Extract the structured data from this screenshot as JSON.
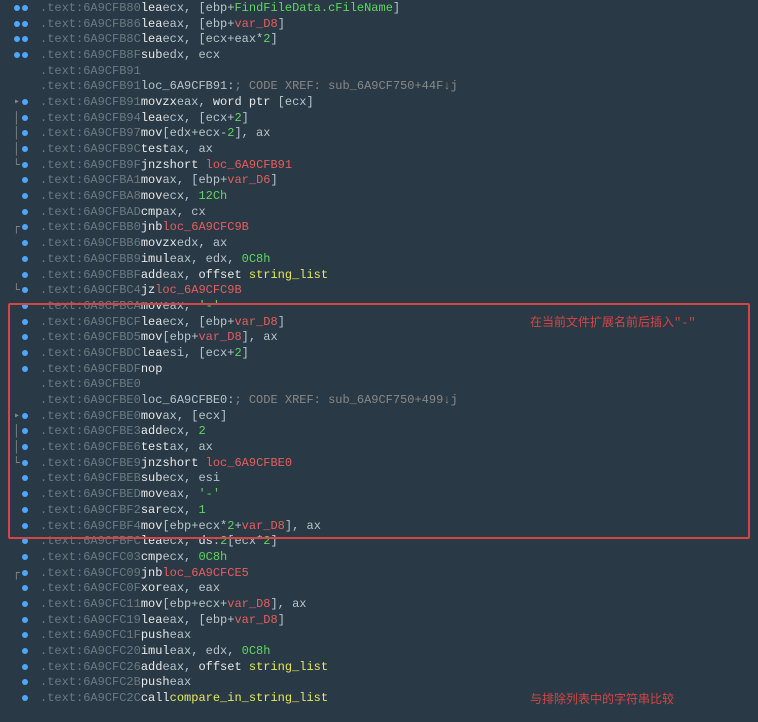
{
  "lines": [
    {
      "g": ".. ",
      "addr": ".text:6A9CFB80",
      "lbl": "",
      "mn": "lea",
      "ops": [
        {
          "t": "ecx, [",
          "c": "op"
        },
        {
          "t": "ebp",
          "c": "op"
        },
        {
          "t": "+",
          "c": "op"
        },
        {
          "t": "FindFileData.cFileName",
          "c": "str"
        },
        {
          "t": "]",
          "c": "op"
        }
      ]
    },
    {
      "g": ".. ",
      "addr": ".text:6A9CFB86",
      "lbl": "",
      "mn": "lea",
      "ops": [
        {
          "t": "eax, [",
          "c": "op"
        },
        {
          "t": "ebp",
          "c": "op"
        },
        {
          "t": "+",
          "c": "op"
        },
        {
          "t": "var_D8",
          "c": "var"
        },
        {
          "t": "]",
          "c": "op"
        }
      ]
    },
    {
      "g": ".. ",
      "addr": ".text:6A9CFB8C",
      "lbl": "",
      "mn": "lea",
      "ops": [
        {
          "t": "ecx, [ecx+eax*",
          "c": "op"
        },
        {
          "t": "2",
          "c": "num"
        },
        {
          "t": "]",
          "c": "op"
        }
      ]
    },
    {
      "g": ".. ",
      "addr": ".text:6A9CFB8F",
      "lbl": "",
      "mn": "sub",
      "ops": [
        {
          "t": "edx, ecx",
          "c": "op"
        }
      ]
    },
    {
      "g": "   ",
      "addr": ".text:6A9CFB91",
      "lbl": "",
      "mn": "",
      "ops": []
    },
    {
      "g": "   ",
      "addr": ".text:6A9CFB91",
      "lbl": "loc_6A9CFB91:",
      "xref": "; CODE XREF: sub_6A9CF750+44F↓j",
      "mn": "",
      "ops": []
    },
    {
      "g": "a. ",
      "addr": ".text:6A9CFB91",
      "lbl": "",
      "mn": "movzx",
      "ops": [
        {
          "t": "eax, ",
          "c": "op"
        },
        {
          "t": "word ptr",
          "c": "kw"
        },
        {
          "t": " [ecx]",
          "c": "op"
        }
      ]
    },
    {
      "g": ":. ",
      "addr": ".text:6A9CFB94",
      "lbl": "",
      "mn": "lea",
      "ops": [
        {
          "t": "ecx, [ecx+",
          "c": "op"
        },
        {
          "t": "2",
          "c": "num"
        },
        {
          "t": "]",
          "c": "op"
        }
      ]
    },
    {
      "g": ":. ",
      "addr": ".text:6A9CFB97",
      "lbl": "",
      "mn": "mov",
      "ops": [
        {
          "t": "[edx+ecx-",
          "c": "op"
        },
        {
          "t": "2",
          "c": "num"
        },
        {
          "t": "], ax",
          "c": "op"
        }
      ]
    },
    {
      "g": ":. ",
      "addr": ".text:6A9CFB9C",
      "lbl": "",
      "mn": "test",
      "ops": [
        {
          "t": "ax, ax",
          "c": "op"
        }
      ]
    },
    {
      "g": "L. ",
      "addr": ".text:6A9CFB9F",
      "lbl": "",
      "mn": "jnz",
      "ops": [
        {
          "t": "short ",
          "c": "kw"
        },
        {
          "t": "loc_6A9CFB91",
          "c": "ref"
        }
      ]
    },
    {
      "g": " . ",
      "addr": ".text:6A9CFBA1",
      "lbl": "",
      "mn": "mov",
      "ops": [
        {
          "t": "ax, [",
          "c": "op"
        },
        {
          "t": "ebp",
          "c": "op"
        },
        {
          "t": "+",
          "c": "op"
        },
        {
          "t": "var_D6",
          "c": "var"
        },
        {
          "t": "]",
          "c": "op"
        }
      ]
    },
    {
      "g": " . ",
      "addr": ".text:6A9CFBA8",
      "lbl": "",
      "mn": "mov",
      "ops": [
        {
          "t": "ecx, ",
          "c": "op"
        },
        {
          "t": "12Ch",
          "c": "num"
        }
      ]
    },
    {
      "g": " . ",
      "addr": ".text:6A9CFBAD",
      "lbl": "",
      "mn": "cmp",
      "ops": [
        {
          "t": "ax, cx",
          "c": "op"
        }
      ]
    },
    {
      "g": "d. ",
      "addr": ".text:6A9CFBB0",
      "lbl": "",
      "mn": "jnb",
      "ops": [
        {
          "t": "loc_6A9CFC9B",
          "c": "ref"
        }
      ]
    },
    {
      "g": " . ",
      "addr": ".text:6A9CFBB6",
      "lbl": "",
      "mn": "movzx",
      "ops": [
        {
          "t": "edx, ax",
          "c": "op"
        }
      ]
    },
    {
      "g": " . ",
      "addr": ".text:6A9CFBB9",
      "lbl": "",
      "mn": "imul",
      "ops": [
        {
          "t": "eax, edx, ",
          "c": "op"
        },
        {
          "t": "0C8h",
          "c": "num"
        }
      ]
    },
    {
      "g": " . ",
      "addr": ".text:6A9CFBBF",
      "lbl": "",
      "mn": "add",
      "ops": [
        {
          "t": "eax, ",
          "c": "op"
        },
        {
          "t": "offset",
          "c": "kw"
        },
        {
          "t": " ",
          "c": "op"
        },
        {
          "t": "string_list",
          "c": "func"
        }
      ]
    },
    {
      "g": "b. ",
      "addr": ".text:6A9CFBC4",
      "lbl": "",
      "mn": "jz",
      "ops": [
        {
          "t": "loc_6A9CFC9B",
          "c": "ref"
        }
      ]
    },
    {
      "g": " . ",
      "addr": ".text:6A9CFBCA",
      "lbl": "",
      "mn": "mov",
      "ops": [
        {
          "t": "eax, ",
          "c": "op"
        },
        {
          "t": "'-'",
          "c": "str"
        }
      ]
    },
    {
      "g": " . ",
      "addr": ".text:6A9CFBCF",
      "lbl": "",
      "mn": "lea",
      "ops": [
        {
          "t": "ecx, [",
          "c": "op"
        },
        {
          "t": "ebp",
          "c": "op"
        },
        {
          "t": "+",
          "c": "op"
        },
        {
          "t": "var_D8",
          "c": "var"
        },
        {
          "t": "]",
          "c": "op"
        }
      ],
      "annot": "在当前文件扩展名前后插入\"-\""
    },
    {
      "g": " . ",
      "addr": ".text:6A9CFBD5",
      "lbl": "",
      "mn": "mov",
      "ops": [
        {
          "t": "[",
          "c": "op"
        },
        {
          "t": "ebp",
          "c": "op"
        },
        {
          "t": "+",
          "c": "op"
        },
        {
          "t": "var_D8",
          "c": "var"
        },
        {
          "t": "], ax",
          "c": "op"
        }
      ]
    },
    {
      "g": " . ",
      "addr": ".text:6A9CFBDC",
      "lbl": "",
      "mn": "lea",
      "ops": [
        {
          "t": "esi, [ecx+",
          "c": "op"
        },
        {
          "t": "2",
          "c": "num"
        },
        {
          "t": "]",
          "c": "op"
        }
      ]
    },
    {
      "g": " . ",
      "addr": ".text:6A9CFBDF",
      "lbl": "",
      "mn": "nop",
      "ops": []
    },
    {
      "g": "   ",
      "addr": ".text:6A9CFBE0",
      "lbl": "",
      "mn": "",
      "ops": []
    },
    {
      "g": "   ",
      "addr": ".text:6A9CFBE0",
      "lbl": "loc_6A9CFBE0:",
      "xref": "; CODE XREF: sub_6A9CF750+499↓j",
      "mn": "",
      "ops": []
    },
    {
      "g": "a. ",
      "addr": ".text:6A9CFBE0",
      "lbl": "",
      "mn": "mov",
      "ops": [
        {
          "t": "ax, [ecx]",
          "c": "op"
        }
      ]
    },
    {
      "g": ":. ",
      "addr": ".text:6A9CFBE3",
      "lbl": "",
      "mn": "add",
      "ops": [
        {
          "t": "ecx, ",
          "c": "op"
        },
        {
          "t": "2",
          "c": "num"
        }
      ]
    },
    {
      "g": ":. ",
      "addr": ".text:6A9CFBE6",
      "lbl": "",
      "mn": "test",
      "ops": [
        {
          "t": "ax, ax",
          "c": "op"
        }
      ]
    },
    {
      "g": "L. ",
      "addr": ".text:6A9CFBE9",
      "lbl": "",
      "mn": "jnz",
      "ops": [
        {
          "t": "short ",
          "c": "kw"
        },
        {
          "t": "loc_6A9CFBE0",
          "c": "ref"
        }
      ]
    },
    {
      "g": " . ",
      "addr": ".text:6A9CFBEB",
      "lbl": "",
      "mn": "sub",
      "ops": [
        {
          "t": "ecx, esi",
          "c": "op"
        }
      ]
    },
    {
      "g": " . ",
      "addr": ".text:6A9CFBED",
      "lbl": "",
      "mn": "mov",
      "ops": [
        {
          "t": "eax, ",
          "c": "op"
        },
        {
          "t": "'-'",
          "c": "str"
        }
      ]
    },
    {
      "g": " . ",
      "addr": ".text:6A9CFBF2",
      "lbl": "",
      "mn": "sar",
      "ops": [
        {
          "t": "ecx, ",
          "c": "op"
        },
        {
          "t": "1",
          "c": "num"
        }
      ]
    },
    {
      "g": " . ",
      "addr": ".text:6A9CFBF4",
      "lbl": "",
      "mn": "mov",
      "ops": [
        {
          "t": "[",
          "c": "op"
        },
        {
          "t": "ebp",
          "c": "op"
        },
        {
          "t": "+ecx*",
          "c": "op"
        },
        {
          "t": "2",
          "c": "num"
        },
        {
          "t": "+",
          "c": "op"
        },
        {
          "t": "var_D8",
          "c": "var"
        },
        {
          "t": "], ax",
          "c": "op"
        }
      ]
    },
    {
      "g": " . ",
      "addr": ".text:6A9CFBFC",
      "lbl": "",
      "mn": "lea",
      "ops": [
        {
          "t": "ecx, ",
          "c": "op"
        },
        {
          "t": "ds",
          "c": "kw"
        },
        {
          "t": ":",
          "c": "op"
        },
        {
          "t": "2",
          "c": "num"
        },
        {
          "t": "[ecx*",
          "c": "op"
        },
        {
          "t": "2",
          "c": "num"
        },
        {
          "t": "]",
          "c": "op"
        }
      ]
    },
    {
      "g": " . ",
      "addr": ".text:6A9CFC03",
      "lbl": "",
      "mn": "cmp",
      "ops": [
        {
          "t": "ecx, ",
          "c": "op"
        },
        {
          "t": "0C8h",
          "c": "num"
        }
      ]
    },
    {
      "g": "d. ",
      "addr": ".text:6A9CFC09",
      "lbl": "",
      "mn": "jnb",
      "ops": [
        {
          "t": "loc_6A9CFCE5",
          "c": "ref"
        }
      ]
    },
    {
      "g": " . ",
      "addr": ".text:6A9CFC0F",
      "lbl": "",
      "mn": "xor",
      "ops": [
        {
          "t": "eax, eax",
          "c": "op"
        }
      ]
    },
    {
      "g": " . ",
      "addr": ".text:6A9CFC11",
      "lbl": "",
      "mn": "mov",
      "ops": [
        {
          "t": "[",
          "c": "op"
        },
        {
          "t": "ebp",
          "c": "op"
        },
        {
          "t": "+ecx+",
          "c": "op"
        },
        {
          "t": "var_D8",
          "c": "var"
        },
        {
          "t": "], ax",
          "c": "op"
        }
      ]
    },
    {
      "g": " . ",
      "addr": ".text:6A9CFC19",
      "lbl": "",
      "mn": "lea",
      "ops": [
        {
          "t": "eax, [",
          "c": "op"
        },
        {
          "t": "ebp",
          "c": "op"
        },
        {
          "t": "+",
          "c": "op"
        },
        {
          "t": "var_D8",
          "c": "var"
        },
        {
          "t": "]",
          "c": "op"
        }
      ]
    },
    {
      "g": " . ",
      "addr": ".text:6A9CFC1F",
      "lbl": "",
      "mn": "push",
      "ops": [
        {
          "t": "eax",
          "c": "op"
        }
      ]
    },
    {
      "g": " . ",
      "addr": ".text:6A9CFC20",
      "lbl": "",
      "mn": "imul",
      "ops": [
        {
          "t": "eax, edx, ",
          "c": "op"
        },
        {
          "t": "0C8h",
          "c": "num"
        }
      ]
    },
    {
      "g": " . ",
      "addr": ".text:6A9CFC26",
      "lbl": "",
      "mn": "add",
      "ops": [
        {
          "t": "eax, ",
          "c": "op"
        },
        {
          "t": "offset",
          "c": "kw"
        },
        {
          "t": " ",
          "c": "op"
        },
        {
          "t": "string_list",
          "c": "func"
        }
      ]
    },
    {
      "g": " . ",
      "addr": ".text:6A9CFC2B",
      "lbl": "",
      "mn": "push",
      "ops": [
        {
          "t": "eax",
          "c": "op"
        }
      ]
    },
    {
      "g": " . ",
      "addr": ".text:6A9CFC2C",
      "lbl": "",
      "mn": "call",
      "ops": [
        {
          "t": "compare_in_string_list",
          "c": "func"
        }
      ],
      "annot": "与排除列表中的字符串比较"
    }
  ]
}
